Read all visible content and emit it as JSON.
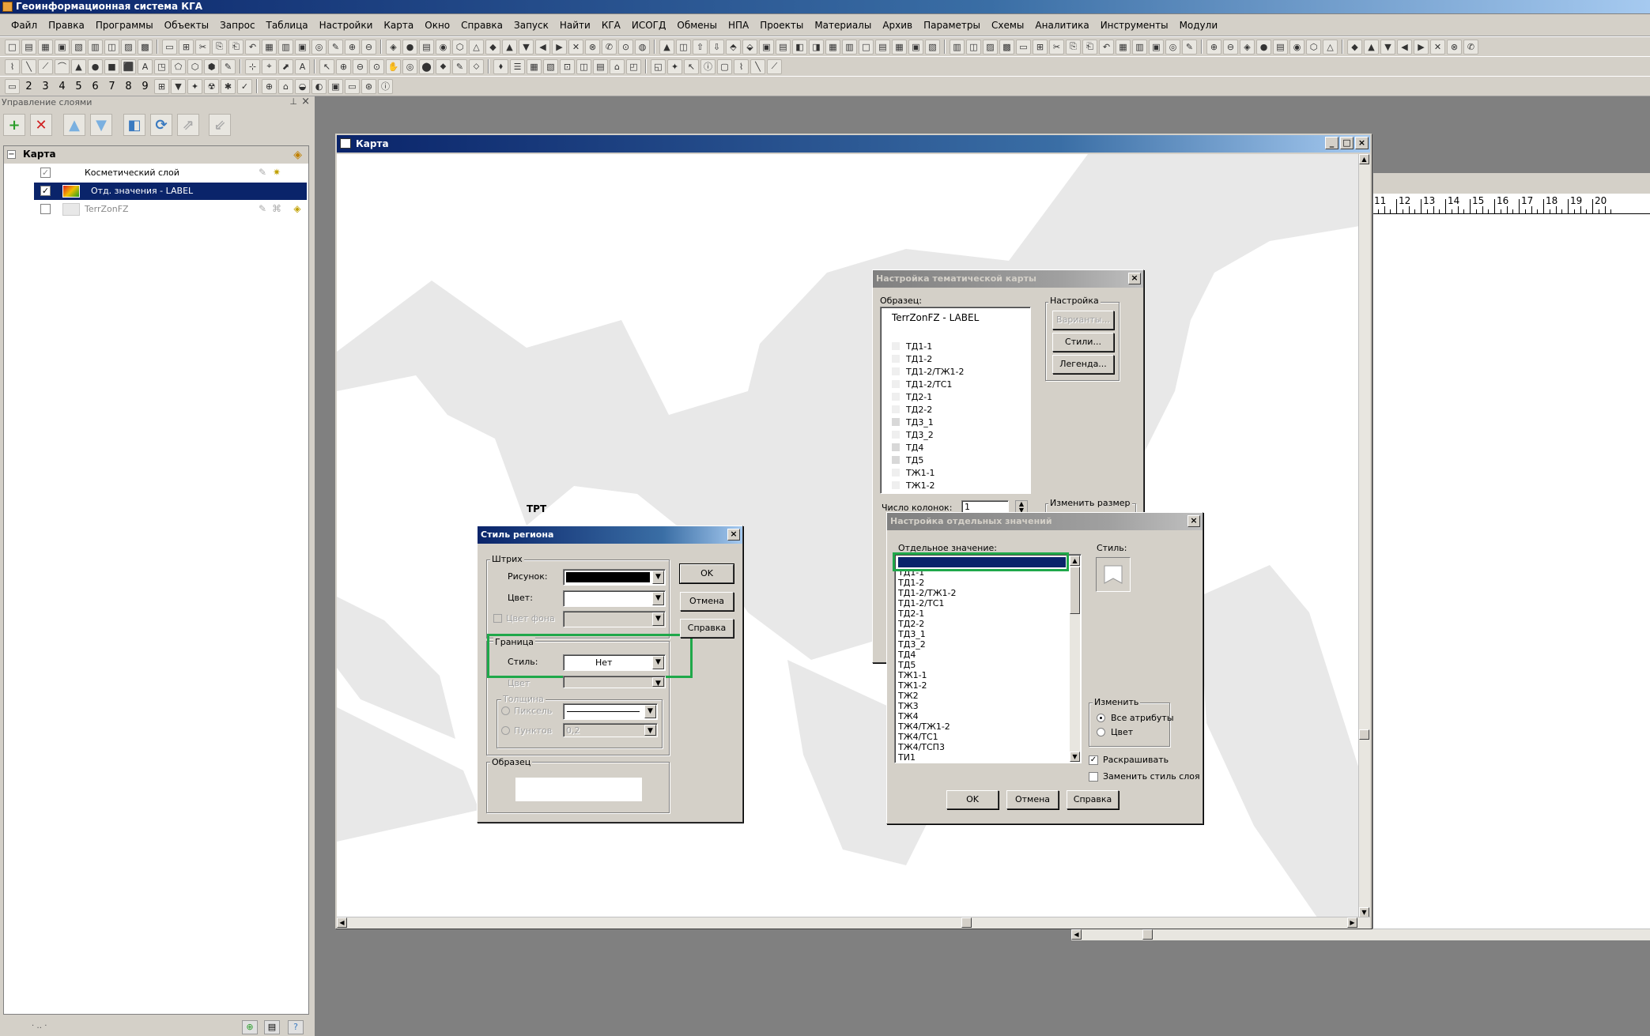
{
  "app": {
    "title": "Геоинформационная система КГА"
  },
  "menu": [
    "Файл",
    "Правка",
    "Программы",
    "Объекты",
    "Запрос",
    "Таблица",
    "Настройки",
    "Карта",
    "Окно",
    "Справка",
    "Запуск",
    "Найти",
    "КГА",
    "ИСОГД",
    "Обмены",
    "НПА",
    "Проекты",
    "Материалы",
    "Архив",
    "Параметры",
    "Схемы",
    "Аналитика",
    "Инструменты",
    "Модули"
  ],
  "toolbar3": {
    "numbers": [
      "2",
      "3",
      "4",
      "5",
      "6",
      "7",
      "8",
      "9"
    ]
  },
  "layers_panel": {
    "title": "Управление слоями",
    "root": "Карта",
    "layers": [
      {
        "label": "Косметический слой",
        "checked": true,
        "selected": false
      },
      {
        "label": "Отд. значения - LABEL",
        "checked": true,
        "selected": true
      },
      {
        "label": "TerrZonFZ",
        "checked": false,
        "selected": false
      }
    ]
  },
  "map_window": {
    "title": "Карта",
    "label_trt": "ТРТ",
    "ruler_numbers": [
      "11",
      "12",
      "13",
      "14",
      "15",
      "16",
      "17",
      "18",
      "19",
      "20"
    ]
  },
  "thematic_dialog": {
    "title": "Настройка тематической карты",
    "sample_label": "Образец:",
    "sample_title": "TerrZonFZ - LABEL",
    "items": [
      "ТД1-1",
      "ТД1-2",
      "ТД1-2/ТЖ1-2",
      "ТД1-2/ТС1",
      "ТД2-1",
      "ТД2-2",
      "ТД3_1",
      "ТД3_2",
      "ТД4",
      "ТД5",
      "ТЖ1-1",
      "ТЖ1-2"
    ],
    "settings_group": "Настройка",
    "btn_variants": "Варианты...",
    "btn_styles": "Стили...",
    "btn_legend": "Легенда...",
    "columns_label": "Число колонок:",
    "columns_value": "1",
    "resize_label": "Изменить размер"
  },
  "region_style_dialog": {
    "title": "Стиль региона",
    "stroke_group": "Штрих",
    "pattern_label": "Рисунок:",
    "color_label": "Цвет:",
    "bg_color_label": "Цвет фона",
    "border_group": "Граница",
    "style_label": "Стиль:",
    "style_value": "Нет",
    "border_color_label": "Цвет",
    "thickness_group": "Толщина",
    "pixel_label": "Пиксель",
    "points_label": "Пунктов",
    "points_value": "0,2",
    "sample_group": "Образец",
    "ok": "OK",
    "cancel": "Отмена",
    "help": "Справка"
  },
  "values_dialog": {
    "title": "Настройка отдельных значений",
    "value_label": "Отдельное значение:",
    "style_label": "Стиль:",
    "items": [
      "",
      "ТД1-1",
      "ТД1-2",
      "ТД1-2/ТЖ1-2",
      "ТД1-2/ТС1",
      "ТД2-1",
      "ТД2-2",
      "ТД3_1",
      "ТД3_2",
      "ТД4",
      "ТД5",
      "ТЖ1-1",
      "ТЖ1-2",
      "ТЖ2",
      "ТЖ3",
      "ТЖ4",
      "ТЖ4/ТЖ1-2",
      "ТЖ4/ТС1",
      "ТЖ4/ТСП3",
      "ТИ1"
    ],
    "change_group": "Изменить",
    "opt_all": "Все атрибуты",
    "opt_color": "Цвет",
    "chk_colorize": "Раскрашивать",
    "chk_replace": "Заменить стиль слоя",
    "ok": "OK",
    "cancel": "Отмена",
    "help": "Справка"
  },
  "colors": {
    "highlight_green": "#1fa84a",
    "selection_navy": "#0a246a"
  }
}
